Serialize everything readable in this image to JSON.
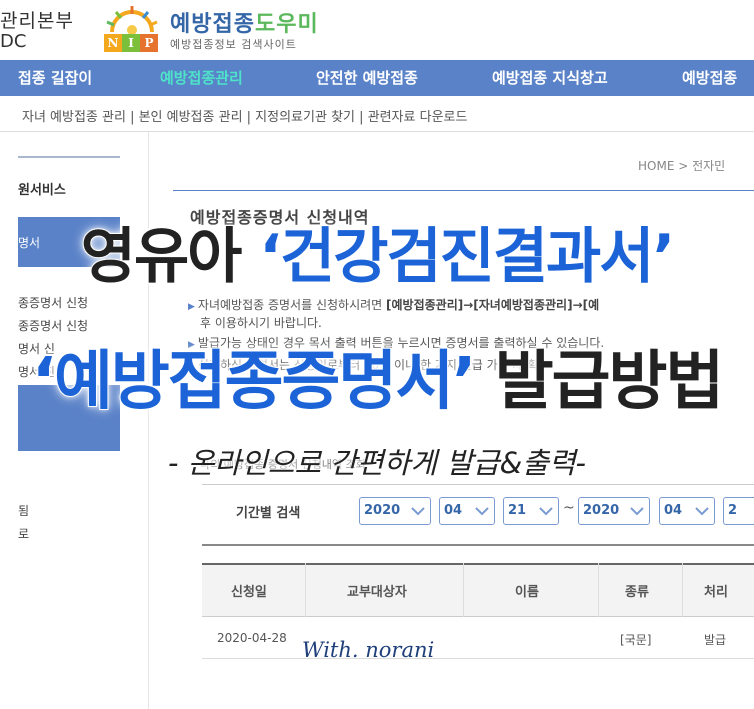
{
  "header": {
    "kdca_name": "관리본부",
    "kdca_code": "DC",
    "nip_letters": [
      "N",
      "I",
      "P"
    ],
    "site_title_main": "예방접종",
    "site_title_accent": "도우미",
    "site_subtitle": "예방접종정보 검색사이트",
    "colors": {
      "title_blue": "#3466a8",
      "title_green": "#5cb85c"
    }
  },
  "nav": {
    "items": [
      {
        "label": "접종 길잡이",
        "active": false
      },
      {
        "label": "예방접종관리",
        "active": true
      },
      {
        "label": "안전한 예방접종",
        "active": false
      },
      {
        "label": "예방접종 지식창고",
        "active": false
      },
      {
        "label": "예방접종",
        "active": false
      }
    ],
    "colors": {
      "bar": "#5a82c8",
      "active_text": "#4ee3c9"
    }
  },
  "subnav": {
    "text": "자녀 예방접종 관리  |  본인 예방접종 관리  |  지정의료기관 찾기  |  관련자료 다운로드"
  },
  "sidebar": {
    "title": "원서비스",
    "active_label": "명서",
    "links": [
      "종증명서 신청",
      "종증명서 신청",
      "명서 신",
      "명서 진"
    ],
    "mini": [
      "됨",
      "로"
    ]
  },
  "main": {
    "breadcrumb": "HOME > 전자민",
    "section_title": "예방접종증명서 신청내역",
    "notices": [
      {
        "text": "자녀예방접종 증명서를 신청하시려면 ",
        "bold": "[예방접종관리]→[자녀예방접종관리]→[예"
      },
      {
        "text": "후 이용하시기 바랍니다.",
        "bold": ""
      },
      {
        "text": "발급가능 상태인 경우 목서 출력 버튼을 누르시면 증명서를 출력하실 수 있습니다.",
        "bold": ""
      },
      {
        "text": "신청하신 증명서는 신청일로부터 90일 이내 한 가지 발급 가능 제 확",
        "bold": ""
      }
    ],
    "search_sub": "나의 예방접종 증명서 신청내역 조회",
    "filter": {
      "label": "기간별 검색",
      "from_year": "2020",
      "from_month": "04",
      "from_day": "21",
      "separator": "~",
      "to_year": "2020",
      "to_month": "04",
      "to_day": "2"
    },
    "table": {
      "headers": [
        "신청일",
        "교부대상자",
        "이름",
        "종류",
        "처리"
      ],
      "rows": [
        {
          "date": "2020-04-28",
          "recipient": "",
          "name": "",
          "kind": "[국문]",
          "status": "발급"
        }
      ]
    }
  },
  "overlay": {
    "line1_pre": "영유아 ",
    "line1_highlight": "‘건강검진결과서’",
    "line2_highlight": "‘예방접종증명서’",
    "line2_post": " 발급방법",
    "line3": "- 온라인으로 간편하게 발급&출력-",
    "signature": "With. norani",
    "colors": {
      "highlight_blue": "#1b63d6",
      "dark_text": "#222222"
    }
  }
}
